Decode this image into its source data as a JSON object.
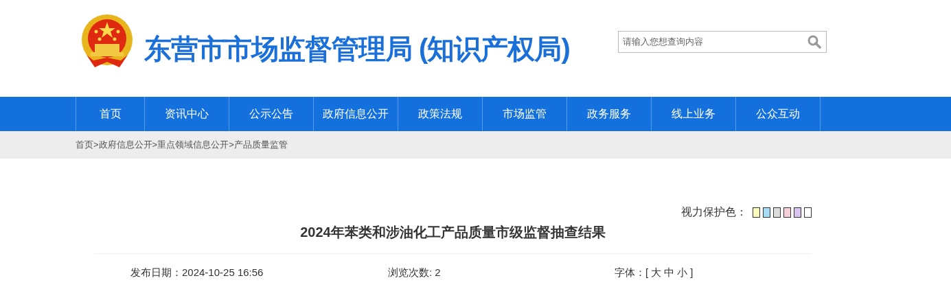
{
  "header": {
    "title": "东营市市场监督管理局 (知识产权局)",
    "search": {
      "placeholder": "请输入您想查询内容"
    }
  },
  "nav": [
    {
      "label": "首页"
    },
    {
      "label": "资讯中心"
    },
    {
      "label": "公示公告"
    },
    {
      "label": "政府信息公开"
    },
    {
      "label": "政策法规"
    },
    {
      "label": "市场监管"
    },
    {
      "label": "政务服务"
    },
    {
      "label": "线上业务"
    },
    {
      "label": "公众互动"
    }
  ],
  "breadcrumb": {
    "separator": ">",
    "items": [
      "首页",
      "政府信息公开",
      "重点领域信息公开",
      "产品质量监管"
    ]
  },
  "eye_care": {
    "label": "视力保护色：",
    "swatches": [
      {
        "color": "#fafabe"
      },
      {
        "color": "#a6dcf5"
      },
      {
        "color": "#dcdcdc"
      },
      {
        "color": "#f5d0d8"
      },
      {
        "color": "#d9c4f0"
      },
      {
        "color": "#ffffff"
      }
    ]
  },
  "article": {
    "title": "2024年苯类和涉油化工产品质量市级监督抽查结果",
    "date": "发布日期：2024-10-25 16:56",
    "views": "浏览次数: 2",
    "font_size": {
      "open": "字体：[",
      "options": [
        "大",
        "中",
        "小"
      ],
      "close": "]"
    }
  }
}
